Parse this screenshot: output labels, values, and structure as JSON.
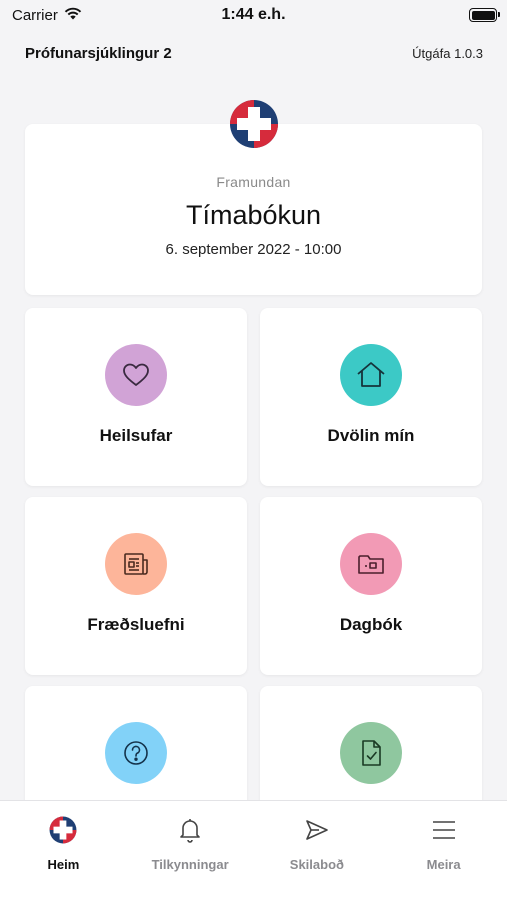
{
  "status_bar": {
    "carrier": "Carrier",
    "time": "1:44 e.h."
  },
  "header": {
    "patient_name": "Prófunarsjúklingur 2",
    "version": "Útgáfa 1.0.3"
  },
  "featured": {
    "label": "Framundan",
    "title": "Tímabókun",
    "date": "6. september 2022 - 10:00"
  },
  "tiles": [
    {
      "label": "Heilsufar",
      "icon": "heart-icon",
      "color": "#d1a3d6"
    },
    {
      "label": "Dvölin mín",
      "icon": "home-icon",
      "color": "#3cc9c6"
    },
    {
      "label": "Fræðsluefni",
      "icon": "newspaper-icon",
      "color": "#fdb59a"
    },
    {
      "label": "Dagbók",
      "icon": "folder-icon",
      "color": "#f29ab5"
    },
    {
      "label": "",
      "icon": "help-icon",
      "color": "#82d2f8"
    },
    {
      "label": "",
      "icon": "document-check-icon",
      "color": "#8fc79f"
    }
  ],
  "tabs": [
    {
      "label": "Heim",
      "icon": "home-logo-icon",
      "active": true
    },
    {
      "label": "Tilkynningar",
      "icon": "bell-icon",
      "active": false
    },
    {
      "label": "Skilaboð",
      "icon": "send-icon",
      "active": false
    },
    {
      "label": "Meira",
      "icon": "menu-icon",
      "active": false
    }
  ],
  "colors": {
    "brand_red": "#d62b3c",
    "brand_blue": "#1f3f74",
    "background": "#f4f4f6"
  }
}
